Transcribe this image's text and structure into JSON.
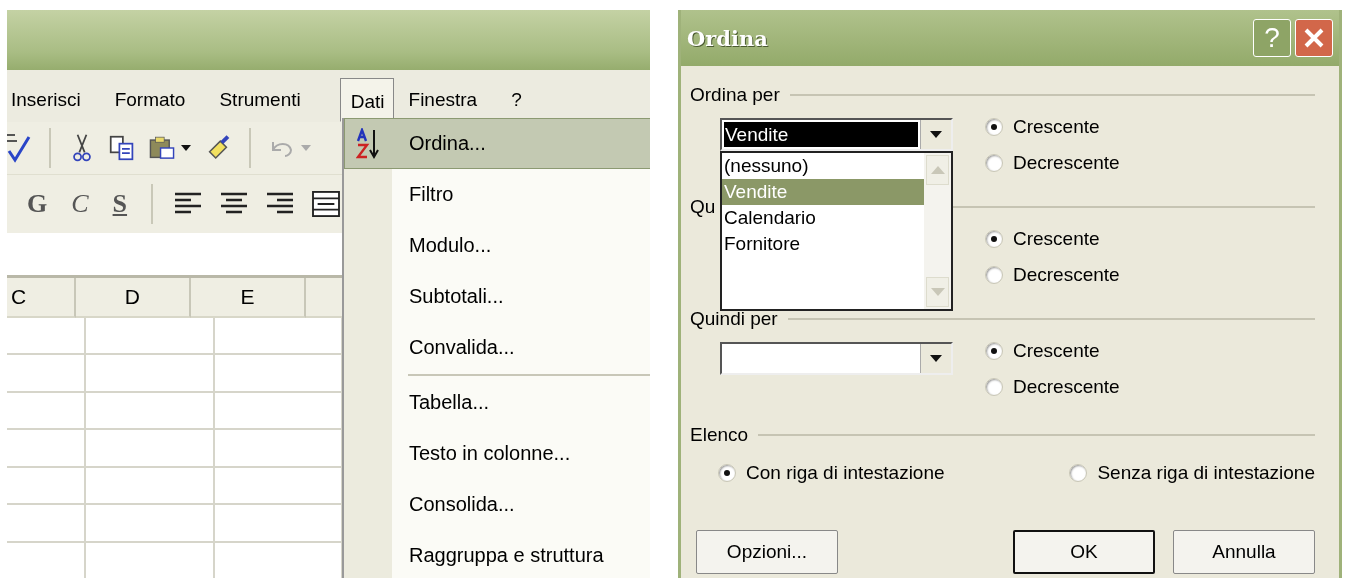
{
  "excel": {
    "menu_bar": [
      {
        "label": "Inserisci",
        "selected": false
      },
      {
        "label": "Formato",
        "selected": false
      },
      {
        "label": "Strumenti",
        "selected": false
      },
      {
        "label": "Dati",
        "selected": true
      },
      {
        "label": "Finestra",
        "selected": false
      },
      {
        "label": "?",
        "selected": false
      }
    ],
    "format_buttons": [
      "G",
      "C",
      "S"
    ],
    "column_headers": [
      "C",
      "D",
      "E"
    ],
    "menu_groups": [
      [
        {
          "label": "Ordina...",
          "selected": true,
          "kind": "sort"
        },
        {
          "label": "Filtro",
          "selected": false
        },
        {
          "label": "Modulo...",
          "selected": false
        },
        {
          "label": "Subtotali...",
          "selected": false
        },
        {
          "label": "Convalida...",
          "selected": false
        }
      ],
      [
        {
          "label": "Tabella...",
          "selected": false
        },
        {
          "label": "Testo in colonne...",
          "selected": false
        },
        {
          "label": "Consolida...",
          "selected": false
        },
        {
          "label": "Raggruppa e struttura",
          "selected": false
        }
      ]
    ]
  },
  "dialog": {
    "title": "Ordina",
    "help": "?",
    "groups": [
      {
        "label": "Ordina per",
        "combo": {
          "value": "Vendite",
          "focused": true
        },
        "options": [
          {
            "label": "(nessuno)",
            "selected": false
          },
          {
            "label": "Vendite",
            "selected": true
          },
          {
            "label": "Calendario",
            "selected": false
          },
          {
            "label": "Fornitore",
            "selected": false
          }
        ],
        "order": [
          {
            "label": "Crescente",
            "selected": true
          },
          {
            "label": "Decrescente",
            "selected": false
          }
        ]
      },
      {
        "label": "Qu",
        "order": [
          {
            "label": "Crescente",
            "selected": true
          },
          {
            "label": "Decrescente",
            "selected": false
          }
        ]
      },
      {
        "label": "Quindi per",
        "combo": {
          "focused": false
        },
        "order": [
          {
            "label": "Crescente",
            "selected": true
          },
          {
            "label": "Decrescente",
            "selected": false
          }
        ]
      }
    ],
    "list": {
      "label": "Elenco",
      "options": [
        {
          "label": "Con riga di intestazione",
          "selected": true
        },
        {
          "label": "Senza riga di intestazione",
          "selected": false
        }
      ]
    },
    "buttons": [
      {
        "label": "Opzioni...",
        "default": false
      },
      {
        "label": "OK",
        "default": true
      },
      {
        "label": "Annulla",
        "default": false
      }
    ]
  }
}
